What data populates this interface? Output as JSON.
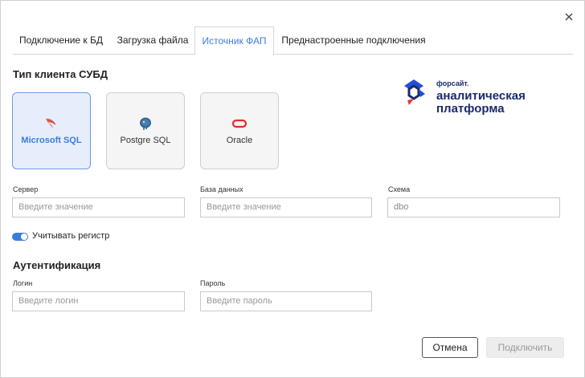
{
  "tabs": [
    {
      "label": "Подключение к БД",
      "active": false
    },
    {
      "label": "Загрузка файла",
      "active": false
    },
    {
      "label": "Источник ФАП",
      "active": true
    },
    {
      "label": "Преднастроенные подключения",
      "active": false
    }
  ],
  "dbms": {
    "title": "Тип клиента СУБД",
    "cards": [
      {
        "label": "Microsoft SQL",
        "icon": "microsoft-sql-icon",
        "selected": true
      },
      {
        "label": "Postgre SQL",
        "icon": "postgresql-icon",
        "selected": false
      },
      {
        "label": "Oracle",
        "icon": "oracle-icon",
        "selected": false
      }
    ]
  },
  "logo": {
    "brand": "форсайт",
    "brand_dot": ".",
    "line1": "аналитическая",
    "line2": "платформа",
    "colors": {
      "navy": "#1b2a6b",
      "blue": "#1e4fd8",
      "red": "#e53935"
    }
  },
  "server": {
    "label": "Сервер",
    "placeholder": "Введите значение"
  },
  "database": {
    "label": "База данных",
    "placeholder": "Введите значение"
  },
  "schema": {
    "label": "Схема",
    "value": "dbo"
  },
  "case_toggle": {
    "label": "Учитывать регистр",
    "on": true
  },
  "auth": {
    "title": "Аутентификация",
    "login": {
      "label": "Логин",
      "placeholder": "Введите логин"
    },
    "password": {
      "label": "Пароль",
      "placeholder": "Введите пароль"
    }
  },
  "buttons": {
    "cancel": "Отмена",
    "connect": "Подключить"
  },
  "colors": {
    "accent": "#3b7ddd",
    "selected_bg": "#e7eefb",
    "disabled_bg": "#ededed"
  }
}
